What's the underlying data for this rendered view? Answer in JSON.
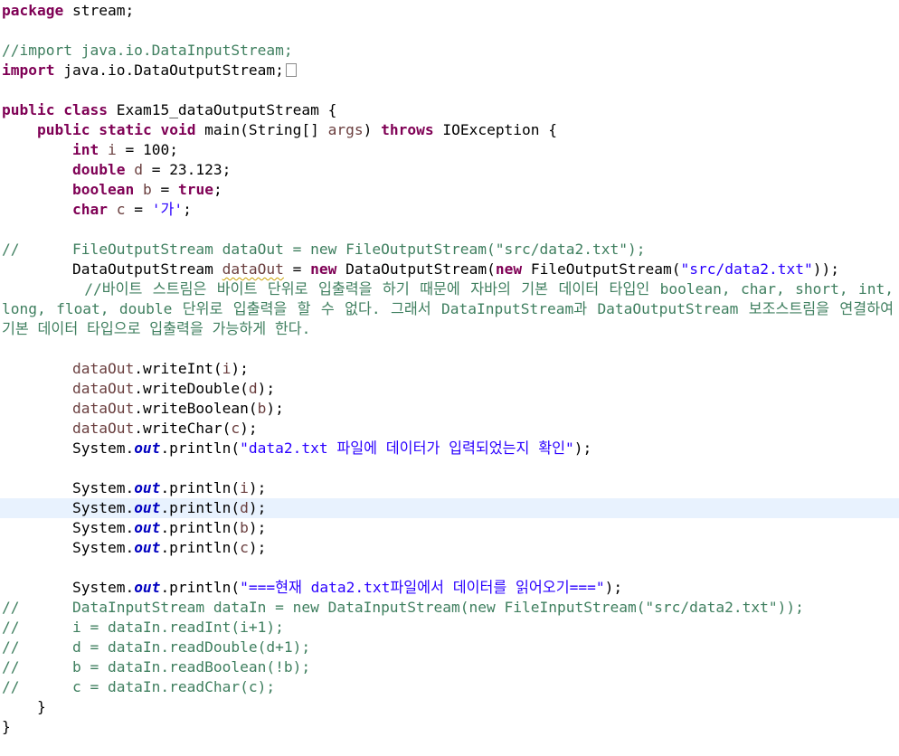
{
  "colors": {
    "keyword": "#7f0055",
    "comment": "#3f7f5f",
    "string": "#2a00ff",
    "field": "#0000c0",
    "static_field": "#0000c0",
    "local_variable": "#6a3e3e",
    "current_line_highlight": "#e8f2fe"
  },
  "editor": {
    "lines": [
      {
        "tokens": [
          {
            "t": "package",
            "c": "kw"
          },
          {
            "t": " stream;"
          }
        ]
      },
      {
        "tokens": []
      },
      {
        "tokens": [
          {
            "t": "//import java.io.DataInputStream;",
            "c": "cm"
          }
        ]
      },
      {
        "tokens": [
          {
            "t": "import",
            "c": "kw"
          },
          {
            "t": " java.io.DataOutputStream;"
          },
          {
            "t": "",
            "c": "fold-box"
          }
        ]
      },
      {
        "tokens": []
      },
      {
        "tokens": [
          {
            "t": "public",
            "c": "kw"
          },
          {
            "t": " "
          },
          {
            "t": "class",
            "c": "kw"
          },
          {
            "t": " Exam15_dataOutputStream {"
          }
        ]
      },
      {
        "tokens": [
          {
            "t": "    "
          },
          {
            "t": "public",
            "c": "kw"
          },
          {
            "t": " "
          },
          {
            "t": "static",
            "c": "kw"
          },
          {
            "t": " "
          },
          {
            "t": "void",
            "c": "kw"
          },
          {
            "t": " main(String[] "
          },
          {
            "t": "args",
            "c": "var"
          },
          {
            "t": ") "
          },
          {
            "t": "throws",
            "c": "kw"
          },
          {
            "t": " IOException {"
          }
        ]
      },
      {
        "tokens": [
          {
            "t": "        "
          },
          {
            "t": "int",
            "c": "kw"
          },
          {
            "t": " "
          },
          {
            "t": "i",
            "c": "var"
          },
          {
            "t": " = 100;"
          }
        ]
      },
      {
        "tokens": [
          {
            "t": "        "
          },
          {
            "t": "double",
            "c": "kw"
          },
          {
            "t": " "
          },
          {
            "t": "d",
            "c": "var"
          },
          {
            "t": " = 23.123;"
          }
        ]
      },
      {
        "tokens": [
          {
            "t": "        "
          },
          {
            "t": "boolean",
            "c": "kw"
          },
          {
            "t": " "
          },
          {
            "t": "b",
            "c": "var"
          },
          {
            "t": " = "
          },
          {
            "t": "true",
            "c": "kw"
          },
          {
            "t": ";"
          }
        ]
      },
      {
        "tokens": [
          {
            "t": "        "
          },
          {
            "t": "char",
            "c": "kw"
          },
          {
            "t": " "
          },
          {
            "t": "c",
            "c": "var"
          },
          {
            "t": " = "
          },
          {
            "t": "'가'",
            "c": "str"
          },
          {
            "t": ";"
          }
        ]
      },
      {
        "tokens": []
      },
      {
        "tokens": [
          {
            "t": "//      FileOutputStream dataOut = new FileOutputStream(\"src/data2.txt\");",
            "c": "cm"
          }
        ]
      },
      {
        "tokens": [
          {
            "t": "        DataOutputStream "
          },
          {
            "t": "dataOut",
            "c": "var squig"
          },
          {
            "t": " = "
          },
          {
            "t": "new",
            "c": "kw"
          },
          {
            "t": " DataOutputStream("
          },
          {
            "t": "new",
            "c": "kw"
          },
          {
            "t": " FileOutputStream("
          },
          {
            "t": "\"src/data2.txt\"",
            "c": "str"
          },
          {
            "t": "));"
          }
        ]
      },
      {
        "justify": true,
        "tokens": [
          {
            "t": "        //바이트 스트림은 바이트 단위로 입출력을 하기 때문에 자바의 기본 데이터 타입인 boolean, char, short, int,",
            "c": "cm"
          }
        ]
      },
      {
        "justify": true,
        "tokens": [
          {
            "t": "long, float, double 단위로 입출력을 할 수 없다. 그래서 DataInputStream과 DataOutputStream 보조스트림을 연결하여",
            "c": "cm"
          }
        ]
      },
      {
        "tokens": [
          {
            "t": "기본 데이터 타입으로 입출력을 가능하게 한다.",
            "c": "cm"
          }
        ]
      },
      {
        "tokens": []
      },
      {
        "tokens": [
          {
            "t": "        "
          },
          {
            "t": "dataOut",
            "c": "var"
          },
          {
            "t": ".writeInt("
          },
          {
            "t": "i",
            "c": "var"
          },
          {
            "t": ");"
          }
        ]
      },
      {
        "tokens": [
          {
            "t": "        "
          },
          {
            "t": "dataOut",
            "c": "var"
          },
          {
            "t": ".writeDouble("
          },
          {
            "t": "d",
            "c": "var"
          },
          {
            "t": ");"
          }
        ]
      },
      {
        "tokens": [
          {
            "t": "        "
          },
          {
            "t": "dataOut",
            "c": "var"
          },
          {
            "t": ".writeBoolean("
          },
          {
            "t": "b",
            "c": "var"
          },
          {
            "t": ");"
          }
        ]
      },
      {
        "tokens": [
          {
            "t": "        "
          },
          {
            "t": "dataOut",
            "c": "var"
          },
          {
            "t": ".writeChar("
          },
          {
            "t": "c",
            "c": "var"
          },
          {
            "t": ");"
          }
        ]
      },
      {
        "tokens": [
          {
            "t": "        System."
          },
          {
            "t": "out",
            "c": "stat"
          },
          {
            "t": ".println("
          },
          {
            "t": "\"data2.txt 파일에 데이터가 입력되었는지 확인\"",
            "c": "str"
          },
          {
            "t": ");"
          }
        ]
      },
      {
        "tokens": []
      },
      {
        "tokens": [
          {
            "t": "        System."
          },
          {
            "t": "out",
            "c": "stat"
          },
          {
            "t": ".println("
          },
          {
            "t": "i",
            "c": "var"
          },
          {
            "t": ");"
          }
        ]
      },
      {
        "highlight": true,
        "tokens": [
          {
            "t": "        System."
          },
          {
            "t": "out",
            "c": "stat"
          },
          {
            "t": ".println("
          },
          {
            "t": "d",
            "c": "var"
          },
          {
            "t": ");"
          }
        ]
      },
      {
        "tokens": [
          {
            "t": "        System."
          },
          {
            "t": "out",
            "c": "stat"
          },
          {
            "t": ".println("
          },
          {
            "t": "b",
            "c": "var"
          },
          {
            "t": ");"
          }
        ]
      },
      {
        "tokens": [
          {
            "t": "        System."
          },
          {
            "t": "out",
            "c": "stat"
          },
          {
            "t": ".println("
          },
          {
            "t": "c",
            "c": "var"
          },
          {
            "t": ");"
          }
        ]
      },
      {
        "tokens": []
      },
      {
        "tokens": [
          {
            "t": "        System."
          },
          {
            "t": "out",
            "c": "stat"
          },
          {
            "t": ".println("
          },
          {
            "t": "\"===현재 data2.txt파일에서 데이터를 읽어오기===\"",
            "c": "str"
          },
          {
            "t": ");"
          }
        ]
      },
      {
        "tokens": [
          {
            "t": "//      DataInputStream dataIn = new DataInputStream(new FileInputStream(\"src/data2.txt\"));",
            "c": "cm"
          }
        ]
      },
      {
        "tokens": [
          {
            "t": "//      i = dataIn.readInt(i+1);",
            "c": "cm"
          }
        ]
      },
      {
        "tokens": [
          {
            "t": "//      d = dataIn.readDouble(d+1);",
            "c": "cm"
          }
        ]
      },
      {
        "tokens": [
          {
            "t": "//      b = dataIn.readBoolean(!b);",
            "c": "cm"
          }
        ]
      },
      {
        "tokens": [
          {
            "t": "//      c = dataIn.readChar(c);",
            "c": "cm"
          }
        ]
      },
      {
        "tokens": [
          {
            "t": "    }"
          }
        ]
      },
      {
        "tokens": [
          {
            "t": "}"
          }
        ]
      }
    ]
  }
}
